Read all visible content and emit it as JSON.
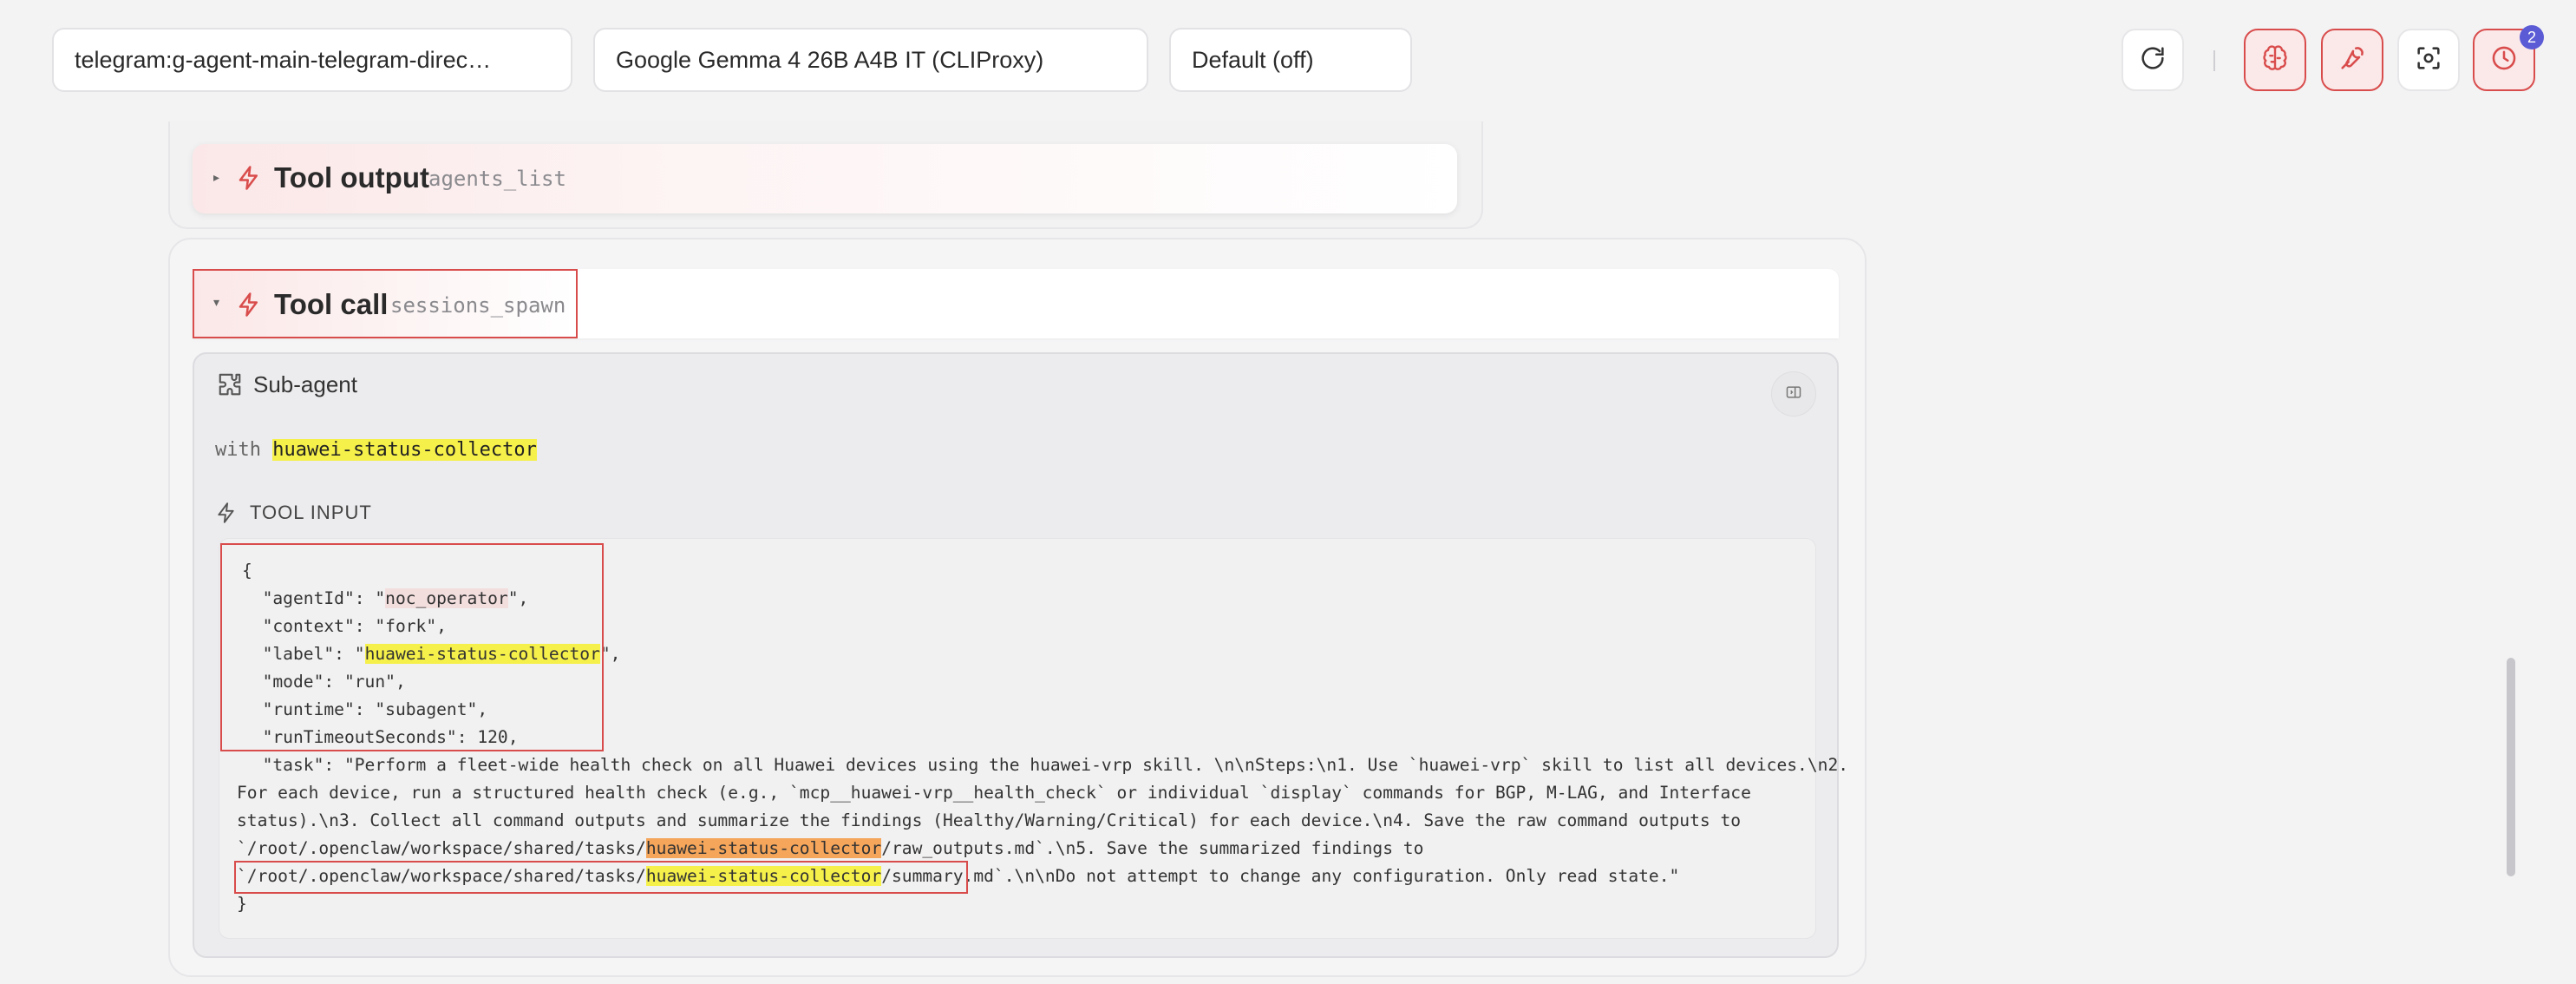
{
  "header": {
    "session_select": "telegram:g-agent-main-telegram-direc…",
    "model_select": "Google Gemma 4 26B A4B IT (CLIProxy)",
    "thinking_select": "Default (off)",
    "divider": "|",
    "cron_badge": "2",
    "icons": [
      "refresh-icon",
      "brain-icon",
      "wrench-icon",
      "focus-icon",
      "clock-icon"
    ]
  },
  "tool_output": {
    "title": "Tool output",
    "name": "agents_list",
    "caret": "▸"
  },
  "tool_call": {
    "title": "Tool call",
    "name": "sessions_spawn",
    "caret": "▾"
  },
  "subagent": {
    "title": "Sub-agent",
    "with_label": "with",
    "agent_label": "huawei-status-collector",
    "tool_input_heading": "TOOL INPUT"
  },
  "code": {
    "open": "{",
    "agentId_key": "  \"agentId\": \"",
    "agentId_val": "noc_operator",
    "agentId_end": "\",",
    "context_line": "  \"context\": \"fork\",",
    "label_key": "  \"label\": \"",
    "label_val": "huawei-status-collector",
    "label_end": "\",",
    "mode_line": "  \"mode\": \"run\",",
    "runtime_line": "  \"runtime\": \"subagent\",",
    "timeout_line": "  \"runTimeoutSeconds\": 120,",
    "task_l1": "  \"task\": \"Perform a fleet-wide health check on all Huawei devices using the huawei-vrp skill. \\n\\nSteps:\\n1. Use `huawei-vrp` skill to list all devices.\\n2.",
    "task_l2": "For each device, run a structured health check (e.g., `mcp__huawei-vrp__health_check` or individual `display` commands for BGP, M-LAG, and Interface",
    "task_l3": "status).\\n3. Collect all command outputs and summarize the findings (Healthy/Warning/Critical) for each device.\\n4. Save the raw command outputs to",
    "task_l4_a": "`/root/.openclaw/workspace/shared/tasks/",
    "task_l4_hl": "huawei-status-collector",
    "task_l4_b": "/raw_outputs.md`.\\n5. Save the summarized findings to",
    "task_l5_a": "`/root/.openclaw/workspace/shared/tasks/",
    "task_l5_hl": "huawei-status-collector",
    "task_l5_b": "/summary.md",
    "task_l5_c": "`.\\n\\nDo not attempt to change any configuration. Only read state.\"",
    "close": "}"
  },
  "colors": {
    "accent_red": "#d94c4c",
    "highlight_yellow": "#f6f04a",
    "highlight_orange": "#f5a65b",
    "badge": "#5b5bd6"
  }
}
